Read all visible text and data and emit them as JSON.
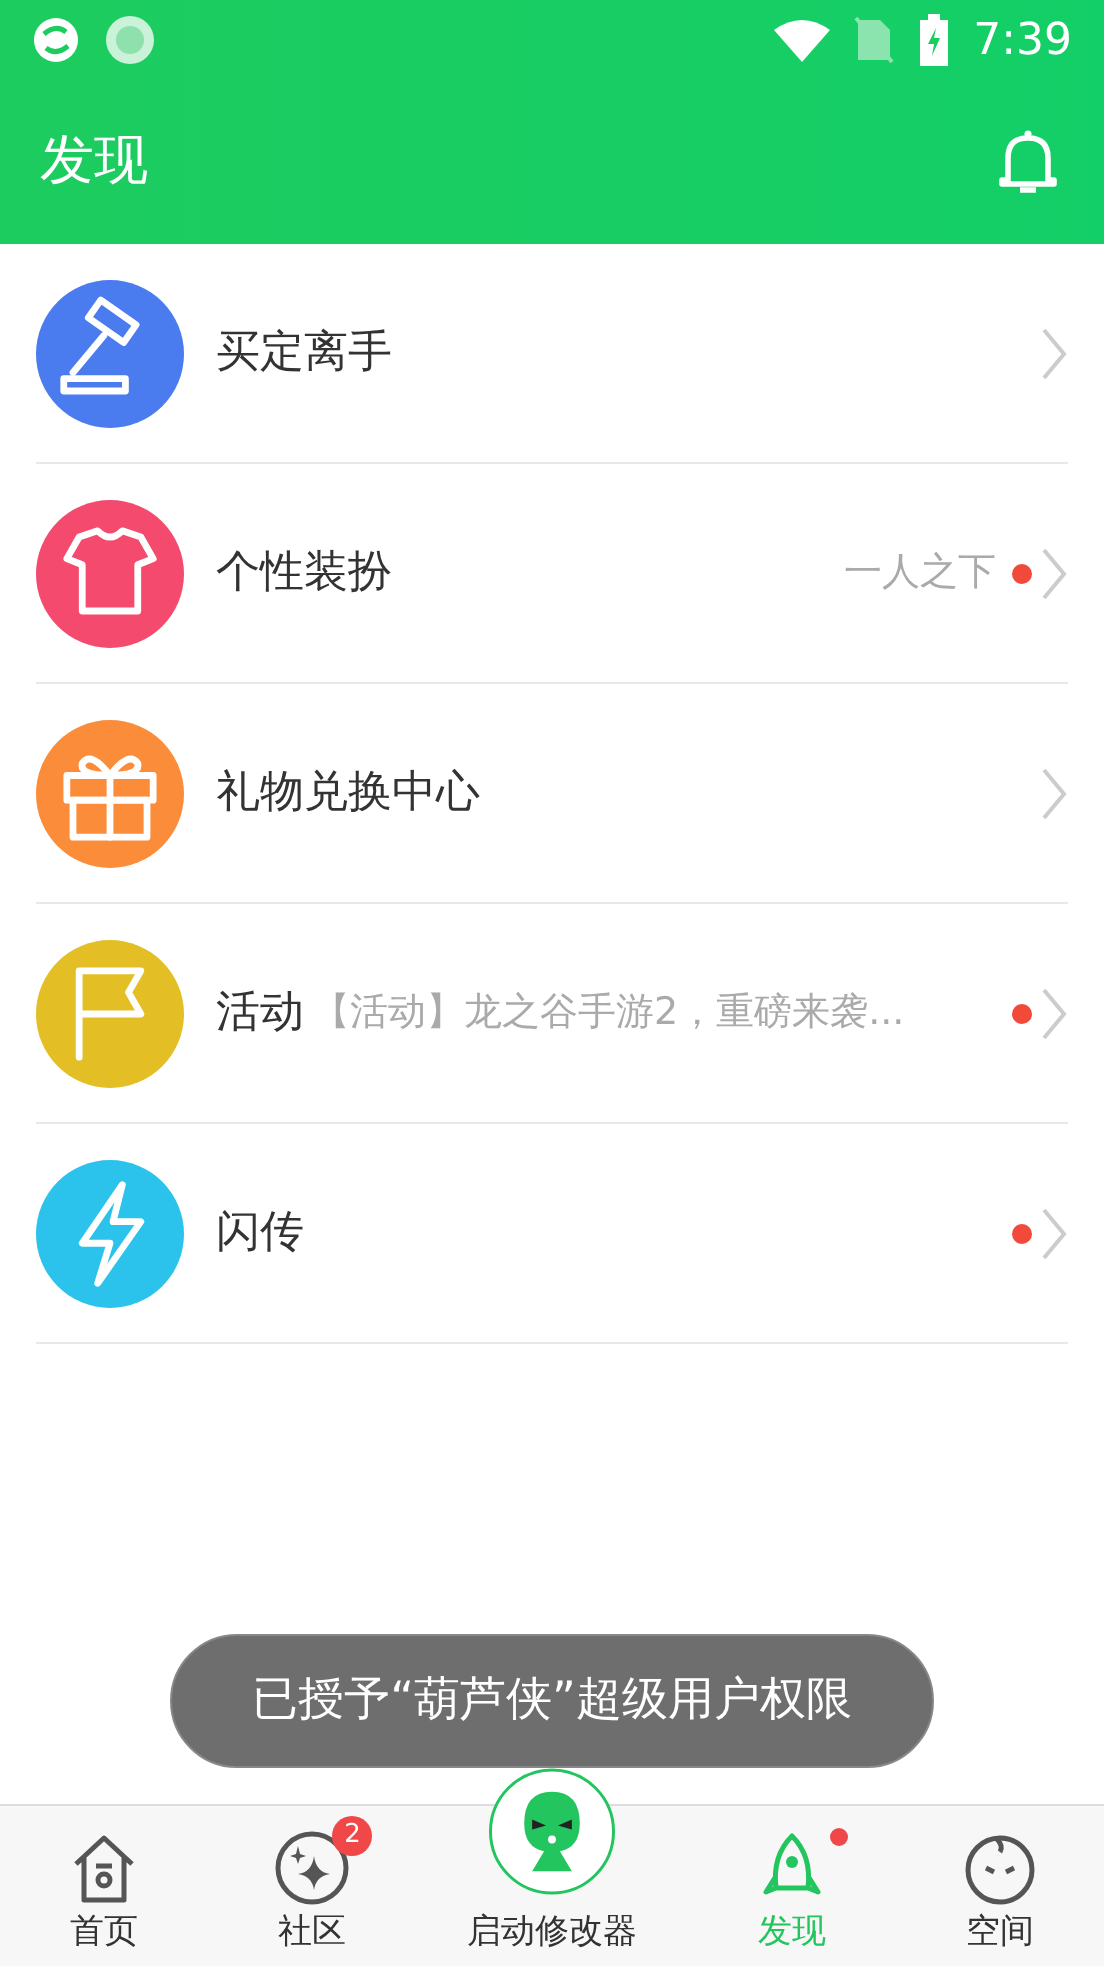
{
  "status_bar": {
    "time": "7:39"
  },
  "header": {
    "title": "发现"
  },
  "items": [
    {
      "title": "买定离手",
      "color": "#4a7cf0",
      "dot": false
    },
    {
      "title": "个性装扮",
      "subtitle": "一人之下",
      "color": "#f44a6e",
      "dot": true
    },
    {
      "title": "礼物兑换中心",
      "color": "#fb8c3a",
      "dot": false
    },
    {
      "title": "活动",
      "subtitle": "【活动】龙之谷手游2，重磅来袭...",
      "color": "#e3bf25",
      "dot": true
    },
    {
      "title": "闪传",
      "color": "#2bc3ec",
      "dot": true
    }
  ],
  "toast": "已授予“葫芦侠”超级用户权限",
  "tabs": [
    {
      "kind": "tab",
      "label": "首页",
      "selected": false,
      "dot": false
    },
    {
      "kind": "tab",
      "label": "社区",
      "selected": false,
      "badge": "2",
      "dot": false
    },
    {
      "kind": "center",
      "label": "启动修改器",
      "selected": false,
      "dot": false
    },
    {
      "kind": "tab",
      "label": "发现",
      "selected": true,
      "dot": true
    },
    {
      "kind": "tab",
      "label": "空间",
      "selected": false,
      "dot": false
    }
  ]
}
